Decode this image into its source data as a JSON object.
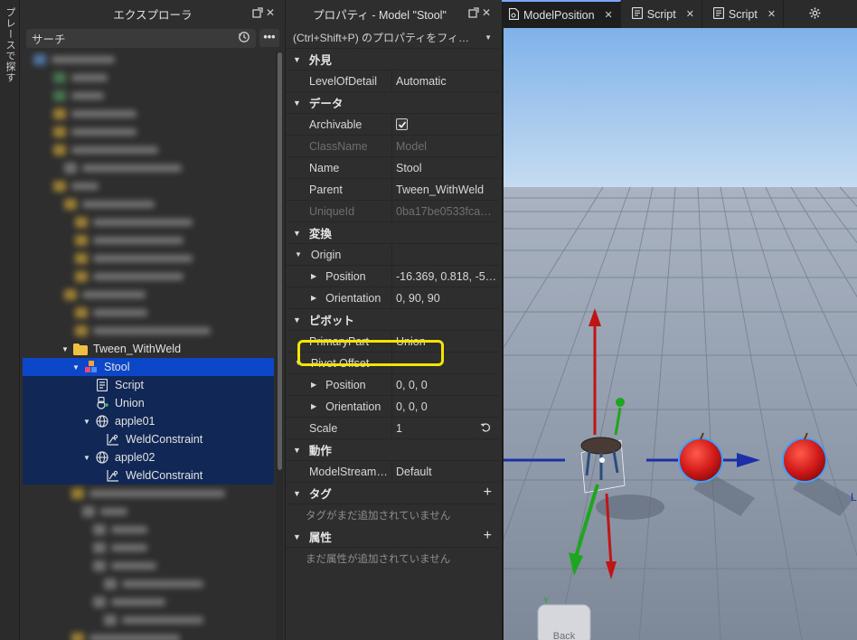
{
  "side_strip": {
    "label": "プレースで探す"
  },
  "explorer": {
    "title": "エクスプローラ",
    "search_placeholder": "サーチ",
    "more_label": "•••",
    "visible_items": [
      {
        "label": "Tween_WithWeld",
        "icon": "folder-icon"
      },
      {
        "label": "Stool",
        "icon": "model-icon"
      },
      {
        "label": "Script",
        "icon": "script-icon"
      },
      {
        "label": "Union",
        "icon": "union-icon"
      },
      {
        "label": "apple01",
        "icon": "globe-icon"
      },
      {
        "label": "WeldConstraint",
        "icon": "weld-constraint-icon"
      },
      {
        "label": "apple02",
        "icon": "globe-icon"
      },
      {
        "label": "WeldConstraint",
        "icon": "weld-constraint-icon"
      }
    ]
  },
  "properties": {
    "title": "プロパティ - Model \"Stool\"",
    "filter_placeholder": "(Ctrl+Shift+P) のプロパティをフィ…",
    "sections": {
      "appearance": "外見",
      "data": "データ",
      "transform": "変換",
      "pivot": "ピボット",
      "behavior": "動作",
      "tags": "タグ",
      "attributes": "属性"
    },
    "rows": {
      "level_of_detail": {
        "name": "LevelOfDetail",
        "value": "Automatic"
      },
      "archivable": {
        "name": "Archivable",
        "checked": true
      },
      "class_name": {
        "name": "ClassName",
        "value": "Model"
      },
      "name": {
        "name": "Name",
        "value": "Stool"
      },
      "parent": {
        "name": "Parent",
        "value": "Tween_WithWeld"
      },
      "unique_id": {
        "name": "UniqueId",
        "value": "0ba17be0533fca…"
      },
      "origin": {
        "name": "Origin"
      },
      "origin_position": {
        "name": "Position",
        "value": "-16.369, 0.818, -5…"
      },
      "origin_orientation": {
        "name": "Orientation",
        "value": "0, 90, 90"
      },
      "primary_part": {
        "name": "PrimaryPart",
        "value": "Union"
      },
      "pivot_offset": {
        "name": "Pivot Offset"
      },
      "pivot_position": {
        "name": "Position",
        "value": "0, 0, 0"
      },
      "pivot_orientation": {
        "name": "Orientation",
        "value": "0, 0, 0"
      },
      "scale": {
        "name": "Scale",
        "value": "1"
      },
      "model_streaming": {
        "name": "ModelStream…",
        "value": "Default"
      }
    },
    "tags_empty": "タグがまだ追加されていません",
    "attributes_empty": "まだ属性が追加されていません"
  },
  "viewport": {
    "tabs": [
      {
        "label": "ModelPosition",
        "active": true
      },
      {
        "label": "Script",
        "active": false
      },
      {
        "label": "Script",
        "active": false
      }
    ],
    "view_cube_label": "Back",
    "axis_label": "Y",
    "colors": {
      "sky_top": "#7fb2ea",
      "floor": "#7f8a9b",
      "x_axis": "#1d2fa8",
      "y_axis": "#c01515",
      "z_axis": "#1ea61e",
      "apple": "#d11a1a"
    }
  }
}
